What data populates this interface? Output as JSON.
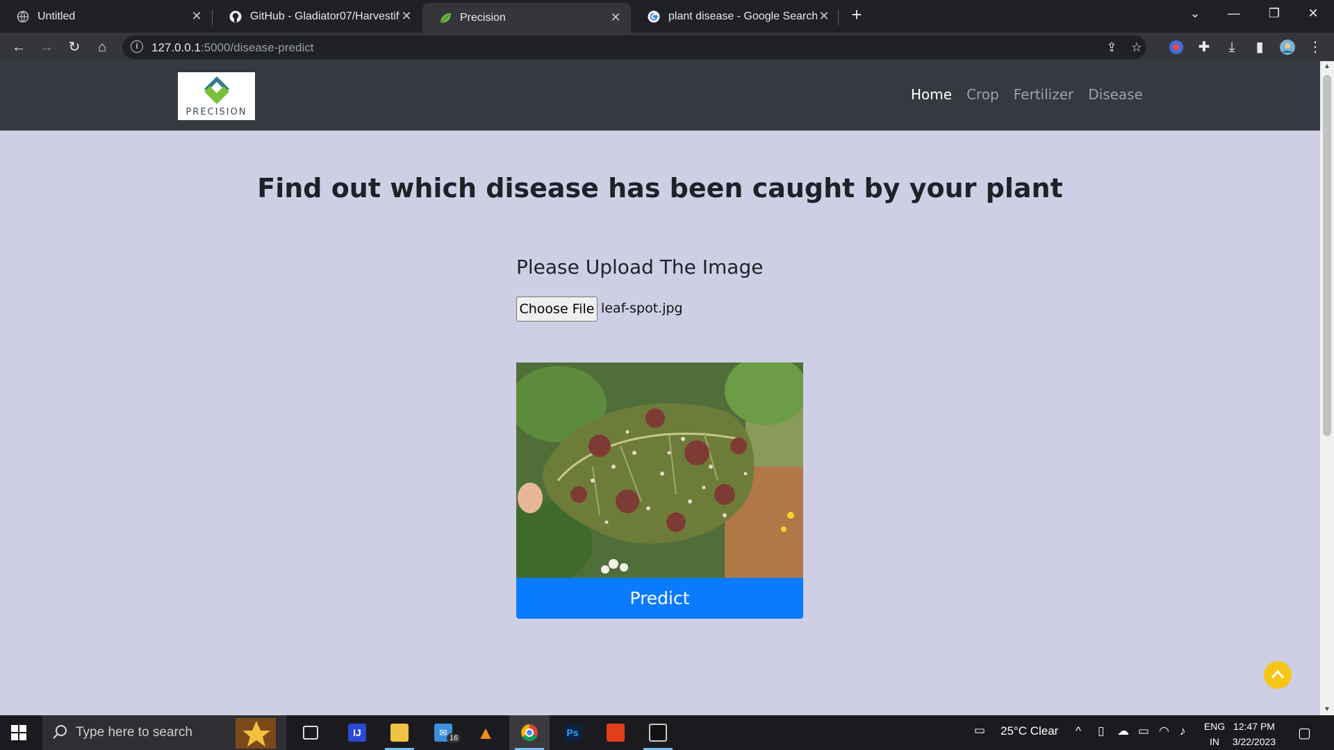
{
  "browser": {
    "tabs": [
      {
        "title": "Untitled",
        "icon": "globe-icon"
      },
      {
        "title": "GitHub - Gladiator07/Harvestify:",
        "icon": "github-icon"
      },
      {
        "title": "Precision",
        "icon": "leaf-icon"
      },
      {
        "title": "plant disease - Google Search",
        "icon": "google-icon"
      }
    ],
    "url_host": "127.0.0.1",
    "url_path": ":5000/disease-predict"
  },
  "site": {
    "logo_text": "PRECISION",
    "nav": [
      {
        "label": "Home",
        "active": true
      },
      {
        "label": "Crop",
        "active": false
      },
      {
        "label": "Fertilizer",
        "active": false
      },
      {
        "label": "Disease",
        "active": false
      }
    ],
    "headline": "Find out which disease has been caught by your plant",
    "upload_label": "Please Upload The Image",
    "choose_file_label": "Choose File",
    "selected_file": "leaf-spot.jpg",
    "predict_label": "Predict",
    "colors": {
      "navbar": "#343a40",
      "page_bg": "#cecfe4",
      "predict": "#0a7bff",
      "to_top": "#f5c518"
    }
  },
  "taskbar": {
    "search_placeholder": "Type here to search",
    "mail_badge": "16",
    "weather": "25°C  Clear",
    "lang_top": "ENG",
    "lang_bottom": "IN",
    "time": "12:47 PM",
    "date": "3/22/2023"
  }
}
